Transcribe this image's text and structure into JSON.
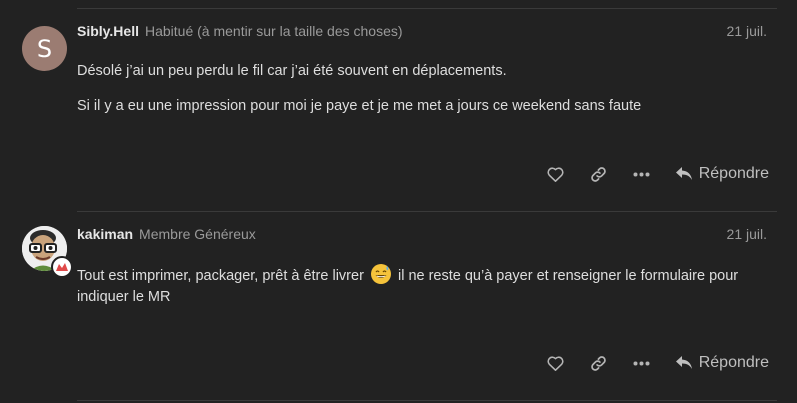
{
  "posts": [
    {
      "username": "Sibly.Hell",
      "user_title": "Habitué (à mentir sur la taille des choses)",
      "date": "21 juil.",
      "avatar_letter": "S",
      "avatar_color": "#9b7c72",
      "paragraphs": [
        "Désolé j’ai un peu perdu le fil car j’ai été souvent en déplacements.",
        "Si il y a eu une impression pour moi je paye et je me met a jours ce weekend sans faute"
      ],
      "actions": {
        "like_icon": "heart-icon",
        "link_icon": "link-icon",
        "more_icon": "ellipsis-icon",
        "reply_label": "Répondre"
      }
    },
    {
      "username": "kakiman",
      "user_title": "Membre Généreux",
      "date": "21 juil.",
      "avatar_icon": "cartoon-avatar-with-glasses",
      "text_before_emoji": "Tout est imprimer, packager, prêt à être livrer",
      "emoji": "grinning-sweat-emoji",
      "text_after_emoji": "il ne reste qu’à payer et renseigner le formulaire pour indiquer le MR",
      "actions": {
        "like_icon": "heart-icon",
        "link_icon": "link-icon",
        "more_icon": "ellipsis-icon",
        "reply_label": "Répondre"
      }
    }
  ],
  "colors": {
    "background": "#222222",
    "divider": "#3a3a3a",
    "text": "#dedede",
    "muted": "#9a9a9a"
  }
}
